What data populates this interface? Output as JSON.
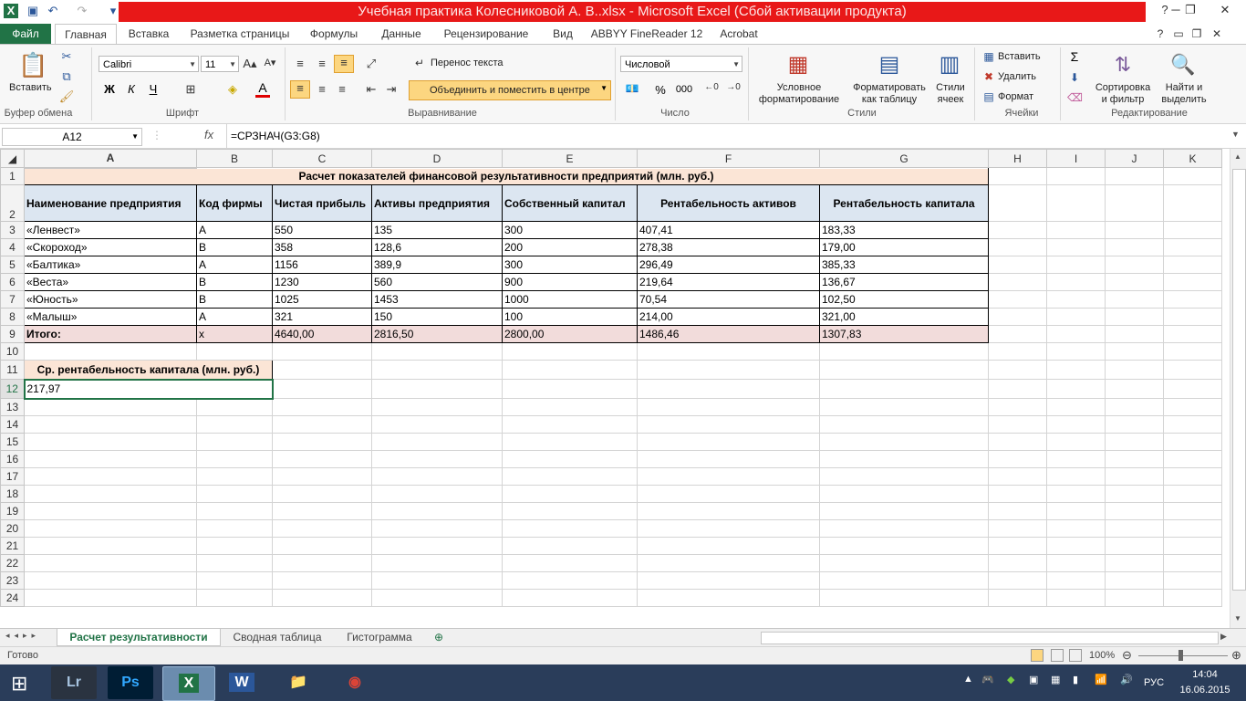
{
  "window": {
    "title": "Учебная практика Колесниковой А. В..xlsx  -  Microsoft Excel (Сбой активации продукта)",
    "help": "?",
    "minimize": "▭",
    "restore": "❐",
    "close": "✕"
  },
  "tabs": [
    "Файл",
    "Главная",
    "Вставка",
    "Разметка страницы",
    "Формулы",
    "Данные",
    "Рецензирование",
    "Вид",
    "ABBYY FineReader 12",
    "Acrobat"
  ],
  "ribbon": {
    "clipboard": {
      "paste": "Вставить",
      "label": "Буфер обмена"
    },
    "font": {
      "name": "Calibri",
      "size": "11",
      "bold": "Ж",
      "italic": "К",
      "underline": "Ч",
      "label": "Шрифт"
    },
    "alignment": {
      "wrap": "Перенос текста",
      "merge": "Объединить и поместить в центре",
      "label": "Выравнивание"
    },
    "number": {
      "format": "Числовой",
      "percent": "%",
      "thousands": "000",
      "label": "Число"
    },
    "styles": {
      "conditional": "Условное",
      "conditional2": "форматирование",
      "table": "Форматировать",
      "table2": "как таблицу",
      "cell": "Стили",
      "cell2": "ячеек",
      "label": "Стили"
    },
    "cells": {
      "insert": "Вставить",
      "delete": "Удалить",
      "format": "Формат",
      "label": "Ячейки"
    },
    "editing": {
      "sigma": "Σ",
      "sort": "Сортировка",
      "sort2": "и фильтр",
      "find": "Найти и",
      "find2": "выделить",
      "label": "Редактирование"
    }
  },
  "formula_bar": {
    "name_box": "A12",
    "fx": "fx",
    "formula": "=СРЗНАЧ(G3:G8)"
  },
  "columns": [
    "A",
    "B",
    "C",
    "D",
    "E",
    "F",
    "G",
    "H",
    "I",
    "J",
    "K"
  ],
  "rows": [
    "1",
    "2",
    "3",
    "4",
    "5",
    "6",
    "7",
    "8",
    "9",
    "10",
    "11",
    "12",
    "13",
    "14",
    "15",
    "16",
    "17",
    "18",
    "19",
    "20",
    "21",
    "22",
    "23",
    "24"
  ],
  "sheet": {
    "title": "Расчет показателей финансовой результативности предприятий (млн. руб.)",
    "headers": [
      "Наименование предприятия",
      "Код фирмы",
      "Чистая прибыль",
      "Активы предприятия",
      "Собственный капитал",
      "Рентабельность активов",
      "Рентабельность капитала"
    ],
    "data": [
      [
        "«Ленвест»",
        "А",
        "550",
        "135",
        "300",
        "407,41",
        "183,33"
      ],
      [
        "«Скороход»",
        "В",
        "358",
        "128,6",
        "200",
        "278,38",
        "179,00"
      ],
      [
        "«Балтика»",
        "А",
        "1156",
        "389,9",
        "300",
        "296,49",
        "385,33"
      ],
      [
        "«Веста»",
        "В",
        "1230",
        "560",
        "900",
        "219,64",
        "136,67"
      ],
      [
        "«Юность»",
        "В",
        "1025",
        "1453",
        "1000",
        "70,54",
        "102,50"
      ],
      [
        "«Малыш»",
        "А",
        "321",
        "150",
        "100",
        "214,00",
        "321,00"
      ]
    ],
    "total": [
      "Итого:",
      "x",
      "4640,00",
      "2816,50",
      "2800,00",
      "1486,46",
      "1307,83"
    ],
    "avg_label": "Ср. рентабельность капитала (млн. руб.)",
    "avg_value": "217,97"
  },
  "sheet_tabs": [
    "Расчет результативности",
    "Сводная таблица",
    "Гистограмма"
  ],
  "status": {
    "ready": "Готово",
    "zoom": "100%"
  },
  "taskbar": {
    "apps": [
      "Lr",
      "Ps",
      "X",
      "W",
      "📁",
      "◉"
    ],
    "lang": "РУС",
    "time": "14:04",
    "date": "16.06.2015"
  }
}
